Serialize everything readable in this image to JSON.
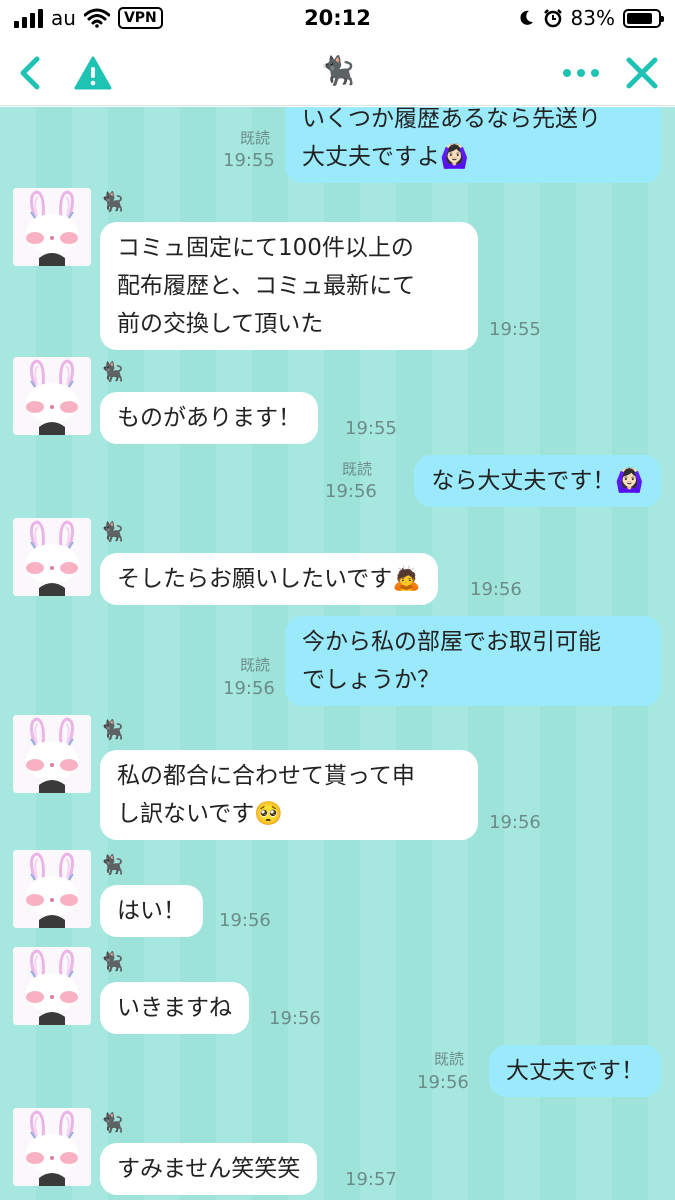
{
  "status_bar": {
    "carrier": "au",
    "vpn": "VPN",
    "time": "20:12",
    "battery": "83%",
    "battery_level": 0.83
  },
  "header": {
    "title": "🐈‍⬛",
    "back_icon": "chevron-left-icon",
    "report_icon": "warning-icon",
    "more_icon": "more-dots-icon",
    "close_icon": "close-icon",
    "accent": "#1ec3b4"
  },
  "chat": {
    "sender_name": "🐈‍⬛",
    "read_label": "既読",
    "colors": {
      "incoming": "#ffffff",
      "outgoing": "#9aeafb",
      "background": "#a6e8e0"
    },
    "messages": [
      {
        "side": "out",
        "text": "いくつか履歴あるなら先送り\n大丈夫ですよ🙆🏻‍♀️",
        "time": "19:55",
        "read": true
      },
      {
        "side": "in",
        "text": "コミュ固定にて100件以上の\n配布履歴と、コミュ最新にて\n前の交換して頂いた",
        "time": "19:55"
      },
      {
        "side": "in",
        "text": "ものがあります！",
        "time": "19:55"
      },
      {
        "side": "out",
        "text": "なら大丈夫です！🙆🏻‍♀️",
        "time": "19:56",
        "read": true
      },
      {
        "side": "in",
        "text": "そしたらお願いしたいです🙇",
        "time": "19:56"
      },
      {
        "side": "out",
        "text": "今から私の部屋でお取引可能\nでしょうか？",
        "time": "19:56",
        "read": true
      },
      {
        "side": "in",
        "text": "私の都合に合わせて貰って申\nし訳ないです🥺",
        "time": "19:56"
      },
      {
        "side": "in",
        "text": "はい！",
        "time": "19:56"
      },
      {
        "side": "in",
        "text": "いきますね",
        "time": "19:56"
      },
      {
        "side": "out",
        "text": "大丈夫です！",
        "time": "19:56",
        "read": true
      },
      {
        "side": "in",
        "text": "すみません笑笑笑",
        "time": "19:57"
      }
    ]
  }
}
